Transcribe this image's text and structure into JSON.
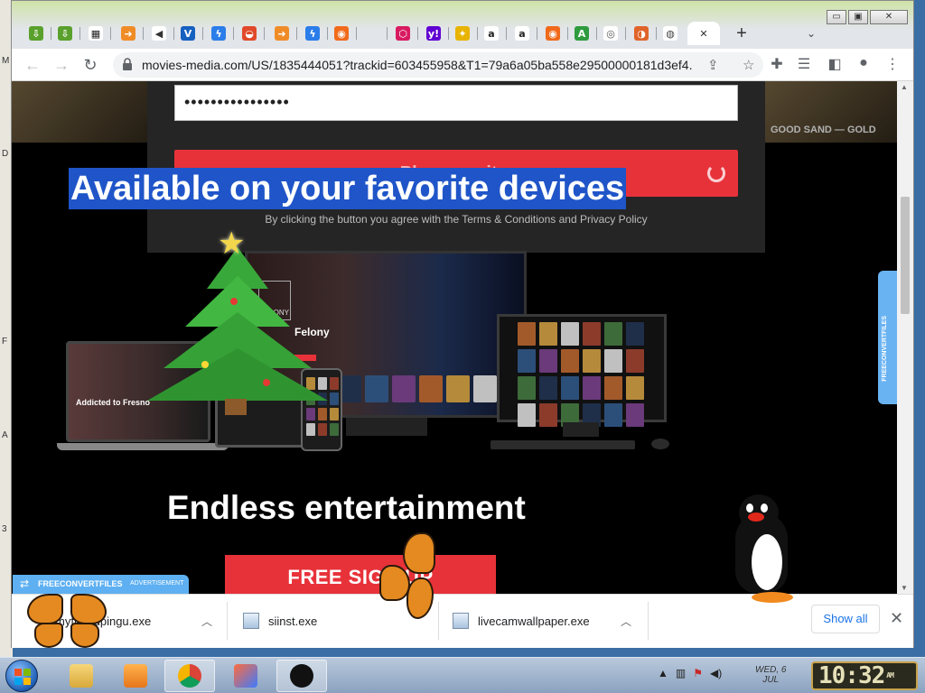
{
  "desktop": {
    "edge_letters": [
      "M",
      "D",
      "F",
      "A",
      "3"
    ]
  },
  "tabs": [
    {
      "icon": "download-arrow-icon",
      "color": "#5aa02c",
      "glyph": "⇩"
    },
    {
      "icon": "download-arrow-icon",
      "color": "#5aa02c",
      "glyph": "⇩"
    },
    {
      "icon": "film-clap-icon",
      "color": "#222222",
      "glyph": "▦"
    },
    {
      "icon": "orange-arrow-icon",
      "color": "#f08c28",
      "glyph": "➜"
    },
    {
      "icon": "speaker-icon",
      "color": "#333333",
      "glyph": "◀"
    },
    {
      "icon": "v-logo-icon",
      "color": "#1660c0",
      "glyph": "V"
    },
    {
      "icon": "bolt-icon",
      "color": "#2b7de9",
      "glyph": "ϟ"
    },
    {
      "icon": "rainbow-icon",
      "color": "#e04a2a",
      "glyph": "◒"
    },
    {
      "icon": "orange-arrow-icon",
      "color": "#f08c28",
      "glyph": "➜"
    },
    {
      "icon": "bolt-icon",
      "color": "#2b7de9",
      "glyph": "ϟ"
    },
    {
      "icon": "firefox-icon",
      "color": "#f06a1a",
      "glyph": "◉"
    },
    {
      "icon": "blank-icon",
      "color": "#e2e5ea",
      "glyph": ""
    },
    {
      "icon": "hexagon-icon",
      "color": "#d81b60",
      "glyph": "⬡"
    },
    {
      "icon": "yahoo-icon",
      "color": "#6001d2",
      "glyph": "y!"
    },
    {
      "icon": "bulb-icon",
      "color": "#e8b400",
      "glyph": "✦"
    },
    {
      "icon": "amazon-icon",
      "color": "#222222",
      "glyph": "a"
    },
    {
      "icon": "amazon-icon",
      "color": "#222222",
      "glyph": "a"
    },
    {
      "icon": "firefox-icon",
      "color": "#f06a1a",
      "glyph": "◉"
    },
    {
      "icon": "green-a-icon",
      "color": "#2e9b3e",
      "glyph": "A"
    },
    {
      "icon": "chrome-gray-icon",
      "color": "#555555",
      "glyph": "◎"
    },
    {
      "icon": "basketball-icon",
      "color": "#e0642a",
      "glyph": "◑"
    },
    {
      "icon": "globe-icon",
      "color": "#444444",
      "glyph": "◍"
    },
    {
      "icon": "close-icon",
      "color": "#333333",
      "glyph": "✕"
    }
  ],
  "browser": {
    "url": "movies-media.com/US/1835444051?trackid=603455958&T1=79a6a05ba558e29500000181d3ef4...",
    "back": "←",
    "forward": "→",
    "reload": "↻",
    "new_tab": "+",
    "tab_search": "⌄",
    "minimize": "▭",
    "maximize": "▣",
    "close": "✕"
  },
  "page": {
    "password_value": "••••••••••••••••",
    "wait_button": "Please wait...",
    "terms": "By clicking the button you agree with the Terms & Conditions and Privacy Policy",
    "headline": "Available on your favorite devices",
    "monitor_movie": "Felony",
    "monitor_badge": "FELONY",
    "laptop_movie": "Addicted to Fresno",
    "sub_headline": "Endless entertainment",
    "free_signup": "FREE SIGN UP",
    "side_tab": "FREECONVERTFILES",
    "ad_brand": "FREECONVERTFILES",
    "ad_label": "ADVERTISEMENT",
    "bg_poster_text": "GOOD SAND — GOLD"
  },
  "downloads": [
    {
      "name": "myfriendpingu.exe"
    },
    {
      "name": "siinst.exe"
    },
    {
      "name": "livecamwallpaper.exe"
    }
  ],
  "shelf": {
    "show_all": "Show all",
    "close": "✕"
  },
  "taskbar": {
    "date_line1": "WED, 6",
    "date_line2": "JUL",
    "time": "10:32",
    "ampm": "AM"
  }
}
